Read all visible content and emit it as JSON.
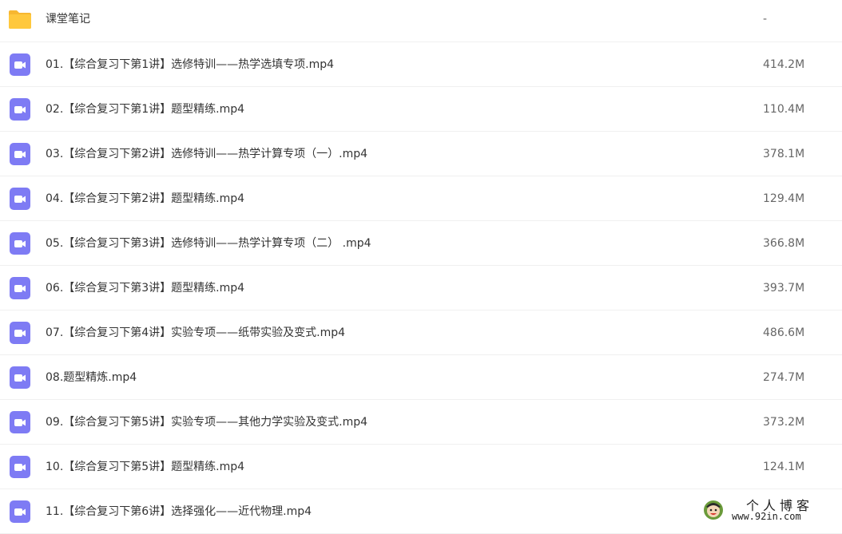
{
  "colors": {
    "folder": "#FFC83D",
    "video_icon": "#7E7BF4",
    "row_divider": "#F0F0F0",
    "size_text": "#666666"
  },
  "files": [
    {
      "icon": "folder-icon",
      "name": "课堂笔记",
      "size": "-"
    },
    {
      "icon": "video-icon",
      "name": "01.【综合复习下第1讲】选修特训——热学选填专项.mp4",
      "size": "414.2M"
    },
    {
      "icon": "video-icon",
      "name": "02.【综合复习下第1讲】题型精练.mp4",
      "size": "110.4M"
    },
    {
      "icon": "video-icon",
      "name": "03.【综合复习下第2讲】选修特训——热学计算专项（一）.mp4",
      "size": "378.1M"
    },
    {
      "icon": "video-icon",
      "name": "04.【综合复习下第2讲】题型精练.mp4",
      "size": "129.4M"
    },
    {
      "icon": "video-icon",
      "name": "05.【综合复习下第3讲】选修特训——热学计算专项（二） .mp4",
      "size": "366.8M"
    },
    {
      "icon": "video-icon",
      "name": "06.【综合复习下第3讲】题型精练.mp4",
      "size": "393.7M"
    },
    {
      "icon": "video-icon",
      "name": "07.【综合复习下第4讲】实验专项——纸带实验及变式.mp4",
      "size": "486.6M"
    },
    {
      "icon": "video-icon",
      "name": "08.题型精炼.mp4",
      "size": "274.7M"
    },
    {
      "icon": "video-icon",
      "name": "09.【综合复习下第5讲】实验专项——其他力学实验及变式.mp4",
      "size": "373.2M"
    },
    {
      "icon": "video-icon",
      "name": "10.【综合复习下第5讲】题型精练.mp4",
      "size": "124.1M"
    },
    {
      "icon": "video-icon",
      "name": "11.【综合复习下第6讲】选择强化——近代物理.mp4",
      "size": ""
    }
  ],
  "watermark": {
    "title": "个人博客",
    "url": "www.92in.com"
  }
}
